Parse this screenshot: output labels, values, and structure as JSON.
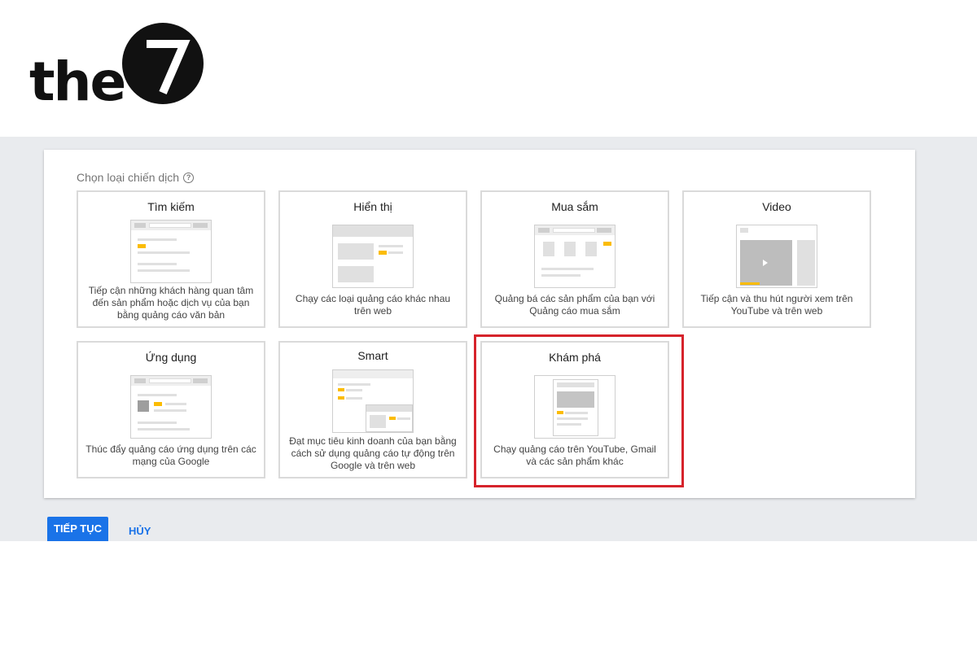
{
  "brand": {
    "logo_text": "the",
    "logo_mark": "7"
  },
  "page": {
    "heading": "Chọn loại chiến dịch",
    "help_icon": "help-circle-icon"
  },
  "campaign_types": [
    {
      "title": "Tìm kiếm",
      "description": "Tiếp cận những khách hàng quan tâm đến sản phẩm hoặc dịch vụ của bạn bằng quảng cáo văn bản",
      "selected": false
    },
    {
      "title": "Hiển thị",
      "description": "Chạy các loại quảng cáo khác nhau trên web",
      "selected": false
    },
    {
      "title": "Mua sắm",
      "description": "Quảng bá các sản phẩm của bạn với Quảng cáo mua sắm",
      "selected": false
    },
    {
      "title": "Video",
      "description": "Tiếp cận và thu hút người xem trên YouTube và trên web",
      "selected": false
    },
    {
      "title": "Ứng dụng",
      "description": "Thúc đẩy quảng cáo ứng dụng trên các mạng của Google",
      "selected": false
    },
    {
      "title": "Smart",
      "description": "Đạt mục tiêu kinh doanh của bạn bằng cách sử dụng quảng cáo tự động trên Google và trên web",
      "selected": false
    },
    {
      "title": "Khám phá",
      "description": "Chạy quảng cáo trên YouTube, Gmail và các sản phẩm khác",
      "selected": true
    }
  ],
  "actions": {
    "continue_label": "TIẾP TỤC",
    "cancel_label": "HỦY"
  },
  "colors": {
    "primary": "#1a73e8",
    "highlight": "#d6232b",
    "accent_yellow": "#fbbc04",
    "background": "#e9ebee"
  }
}
